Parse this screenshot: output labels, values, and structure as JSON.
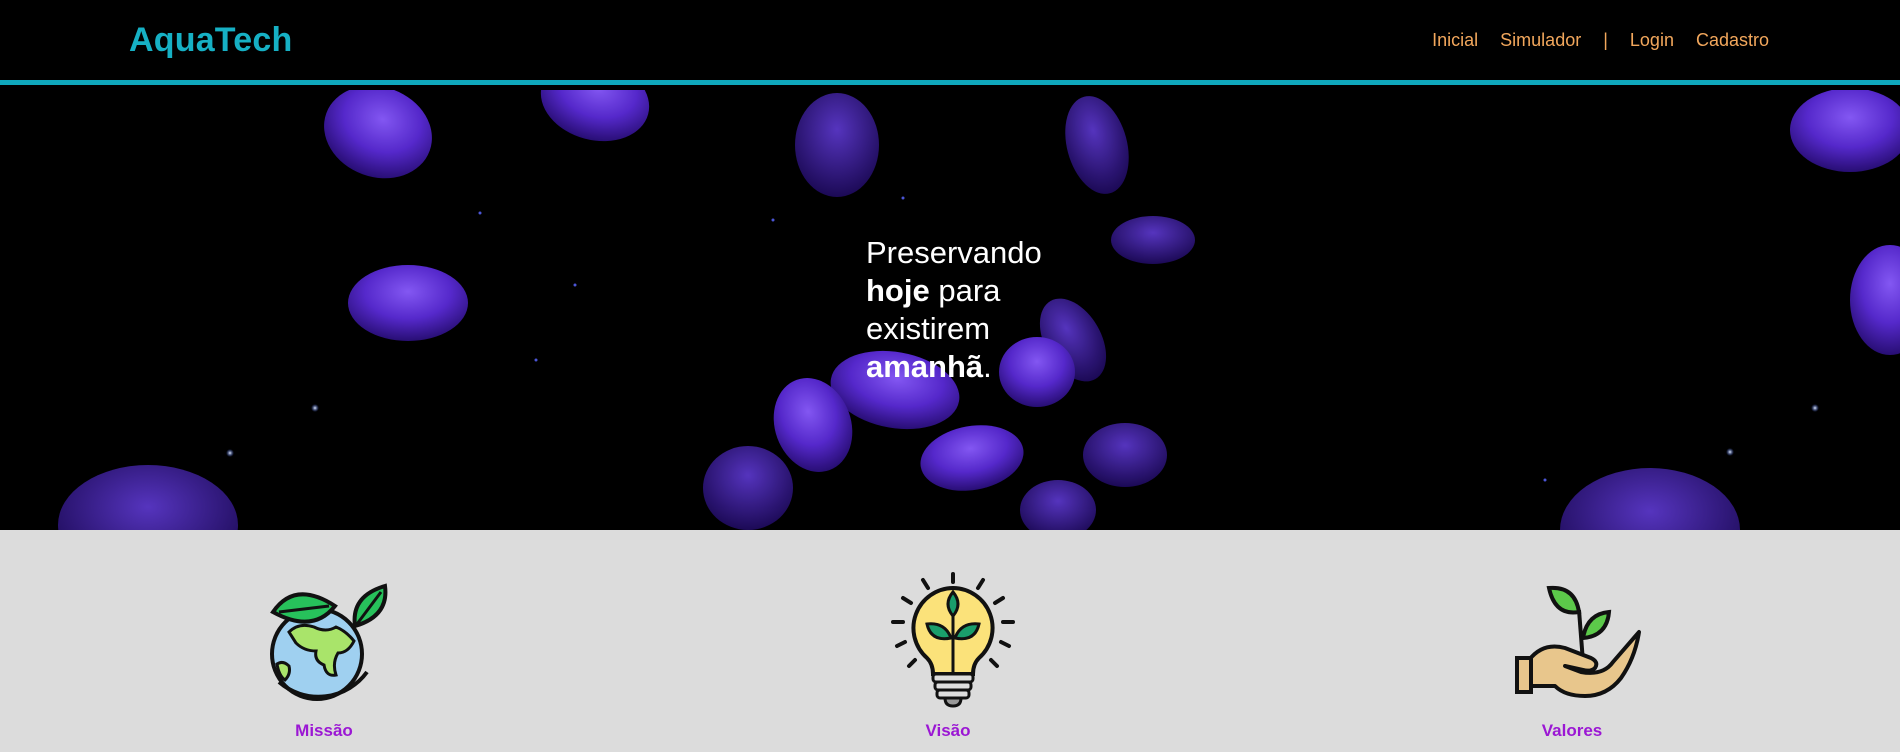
{
  "header": {
    "logo": "AquaTech",
    "nav": {
      "inicial": "Inicial",
      "simulador": "Simulador",
      "separator": "|",
      "login": "Login",
      "cadastro": "Cadastro"
    }
  },
  "hero": {
    "line1": "Preservando",
    "line2_bold": "hoje",
    "line2_rest": " para",
    "line3": "existirem",
    "line4_bold": "amanhã",
    "line4_rest": "."
  },
  "features": {
    "missao": {
      "label": "Missão",
      "icon": "earth-leaf-icon"
    },
    "visao": {
      "label": "Visão",
      "icon": "lightbulb-plant-icon"
    },
    "valores": {
      "label": "Valores",
      "icon": "hand-sprout-icon"
    }
  },
  "colors": {
    "brand": "#16b0c4",
    "nav": "#f2a75c",
    "feature_label": "#9b17d4",
    "jellyfish": "#5a2bd6"
  }
}
